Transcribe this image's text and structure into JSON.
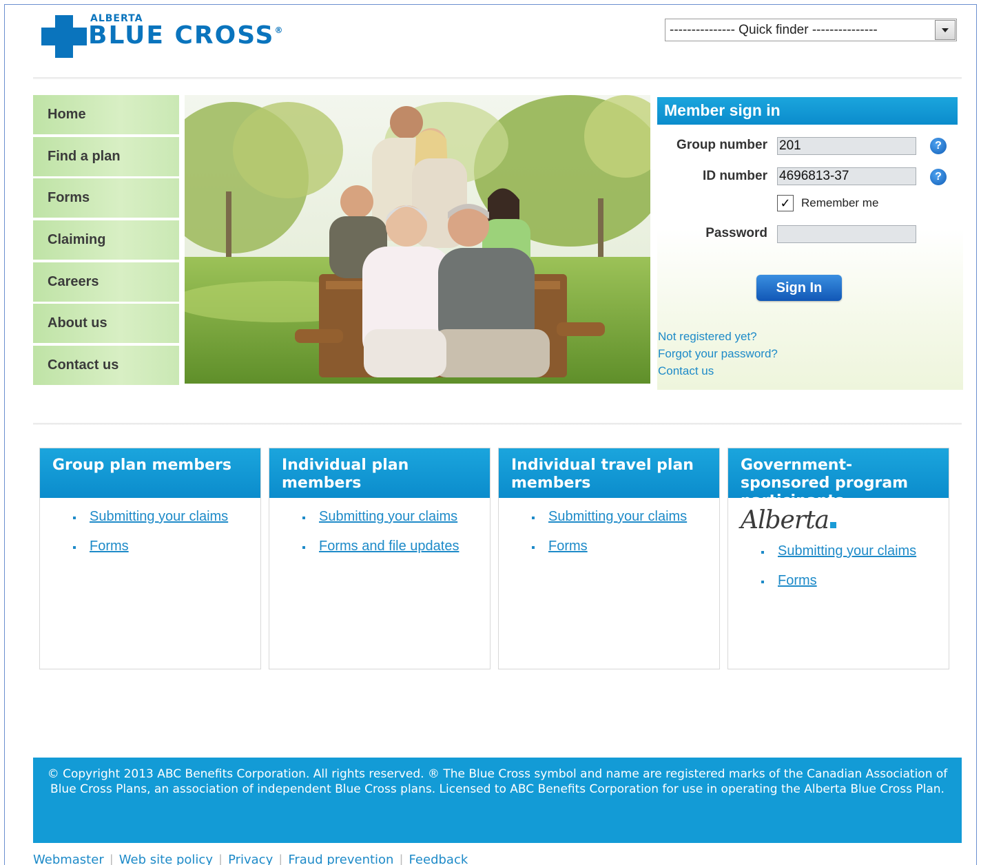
{
  "header": {
    "logo_small": "ALBERTA",
    "logo_main": "BLUE CROSS",
    "logo_mark": "®",
    "quick_finder": "--------------- Quick finder ---------------"
  },
  "nav": [
    "Home",
    "Find a plan",
    "Forms",
    "Claiming",
    "Careers",
    "About us",
    "Contact us"
  ],
  "signin": {
    "title": "Member sign in",
    "group_label": "Group number",
    "group_value": "201",
    "id_label": "ID number",
    "id_value": "4696813-37",
    "remember_label": "Remember me",
    "remember_checked": true,
    "password_label": "Password",
    "button": "Sign In",
    "links": [
      "Not registered yet?",
      "Forgot your password?",
      "Contact us"
    ]
  },
  "cards": [
    {
      "title": "Group plan members",
      "links": [
        "Submitting your claims",
        "Forms"
      ]
    },
    {
      "title": "Individual plan members",
      "links": [
        "Submitting your claims",
        "Forms and file updates"
      ]
    },
    {
      "title": "Individual travel plan members",
      "links": [
        "Submitting your claims",
        "Forms"
      ]
    },
    {
      "title": "Government-sponsored program participants",
      "logo": "Alberta",
      "links": [
        "Submitting your claims",
        "Forms"
      ]
    }
  ],
  "footer": {
    "copyright": "© Copyright 2013 ABC Benefits Corporation. All rights reserved. ® The Blue Cross symbol and name are registered marks of the Canadian Association of Blue Cross Plans, an association of independent Blue Cross plans. Licensed to ABC Benefits Corporation for use in operating the Alberta Blue Cross Plan.",
    "links": [
      "Webmaster",
      "Web site policy",
      "Privacy",
      "Fraud prevention",
      "Feedback"
    ]
  },
  "colors": {
    "brand_blue": "#0a74bd",
    "header_blue": "#139bd6",
    "nav_green": "#cde9b8",
    "link_blue": "#1d8ac8"
  }
}
